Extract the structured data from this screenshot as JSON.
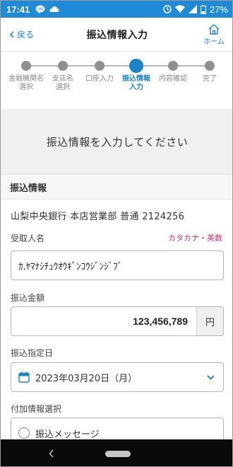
{
  "status_bar": {
    "time": "17:41",
    "battery": "27%",
    "icons": [
      "line-app-icon",
      "cloud-icon",
      "alarm-icon",
      "wifi-icon",
      "signal-icon",
      "battery-icon"
    ]
  },
  "header": {
    "back_label": "戻る",
    "title": "振込情報入力",
    "home_label": "ホーム"
  },
  "stepper": {
    "steps": [
      {
        "label": "金融機関名\n選択",
        "state": "done"
      },
      {
        "label": "支店名\n選択",
        "state": "done"
      },
      {
        "label": "口座入力",
        "state": "done"
      },
      {
        "label": "振込情報\n入力",
        "state": "active"
      },
      {
        "label": "内容確認",
        "state": "pending"
      },
      {
        "label": "完了",
        "state": "pending"
      }
    ]
  },
  "banner": {
    "text": "振込情報を入力してください"
  },
  "section": {
    "title": "振込情報"
  },
  "account": {
    "summary": "山梨中央銀行  本店営業部  普通  2124256"
  },
  "recipient": {
    "label": "受取人名",
    "hint": "カタカナ・英数",
    "value": "ｶ.ﾔﾏﾅｼﾁｭｳｵｳｷﾞﾝｺｳｼﾞﾝｼﾞﾌﾞ"
  },
  "amount": {
    "label": "振込金額",
    "value": "123,456,789",
    "unit": "円"
  },
  "date": {
    "label": "振込指定日",
    "value": "2023年03月20日（月）"
  },
  "extra": {
    "label": "付加情報選択",
    "option_message": "振込メッセージ"
  },
  "colors": {
    "accent": "#1a82c8",
    "status_bar": "#1f8bd8",
    "hint": "#e0286f"
  }
}
